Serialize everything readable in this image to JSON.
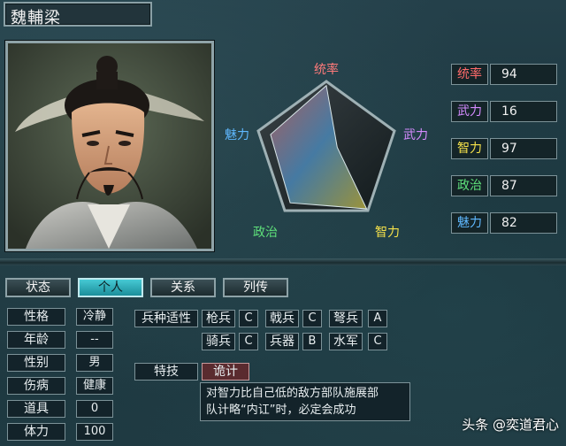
{
  "officer": {
    "name": "魏輔梁"
  },
  "radar": {
    "labels": {
      "leadership": "统率",
      "war": "武力",
      "intelligence": "智力",
      "politics": "政治",
      "charm": "魅力"
    }
  },
  "stats": [
    {
      "label": "统率",
      "value": "94",
      "color": "#ff6a6a"
    },
    {
      "label": "武力",
      "value": "16",
      "color": "#d58bff"
    },
    {
      "label": "智力",
      "value": "97",
      "color": "#f5e14a"
    },
    {
      "label": "政治",
      "value": "87",
      "color": "#5ee07a"
    },
    {
      "label": "魅力",
      "value": "82",
      "color": "#5fb8ff"
    }
  ],
  "tabs": [
    "状态",
    "个人",
    "关系",
    "列传"
  ],
  "active_tab": "个人",
  "personal": [
    {
      "label": "性格",
      "value": "冷静"
    },
    {
      "label": "年龄",
      "value": "--"
    },
    {
      "label": "性别",
      "value": "男"
    },
    {
      "label": "伤病",
      "value": "健康"
    },
    {
      "label": "道具",
      "value": "0"
    },
    {
      "label": "体力",
      "value": "100"
    }
  ],
  "aptitude": {
    "title": "兵种适性",
    "units": [
      {
        "name": "枪兵",
        "grade": "C"
      },
      {
        "name": "戟兵",
        "grade": "C"
      },
      {
        "name": "弩兵",
        "grade": "A"
      },
      {
        "name": "骑兵",
        "grade": "C"
      },
      {
        "name": "兵器",
        "grade": "B"
      },
      {
        "name": "水军",
        "grade": "C"
      }
    ]
  },
  "skill": {
    "title": "特技",
    "name": "诡计",
    "description_line1": "对智力比自己低的敌方部队施展部",
    "description_line2": "队计略“内讧”时，必定会成功"
  },
  "watermark": "头条 @奕道君心"
}
